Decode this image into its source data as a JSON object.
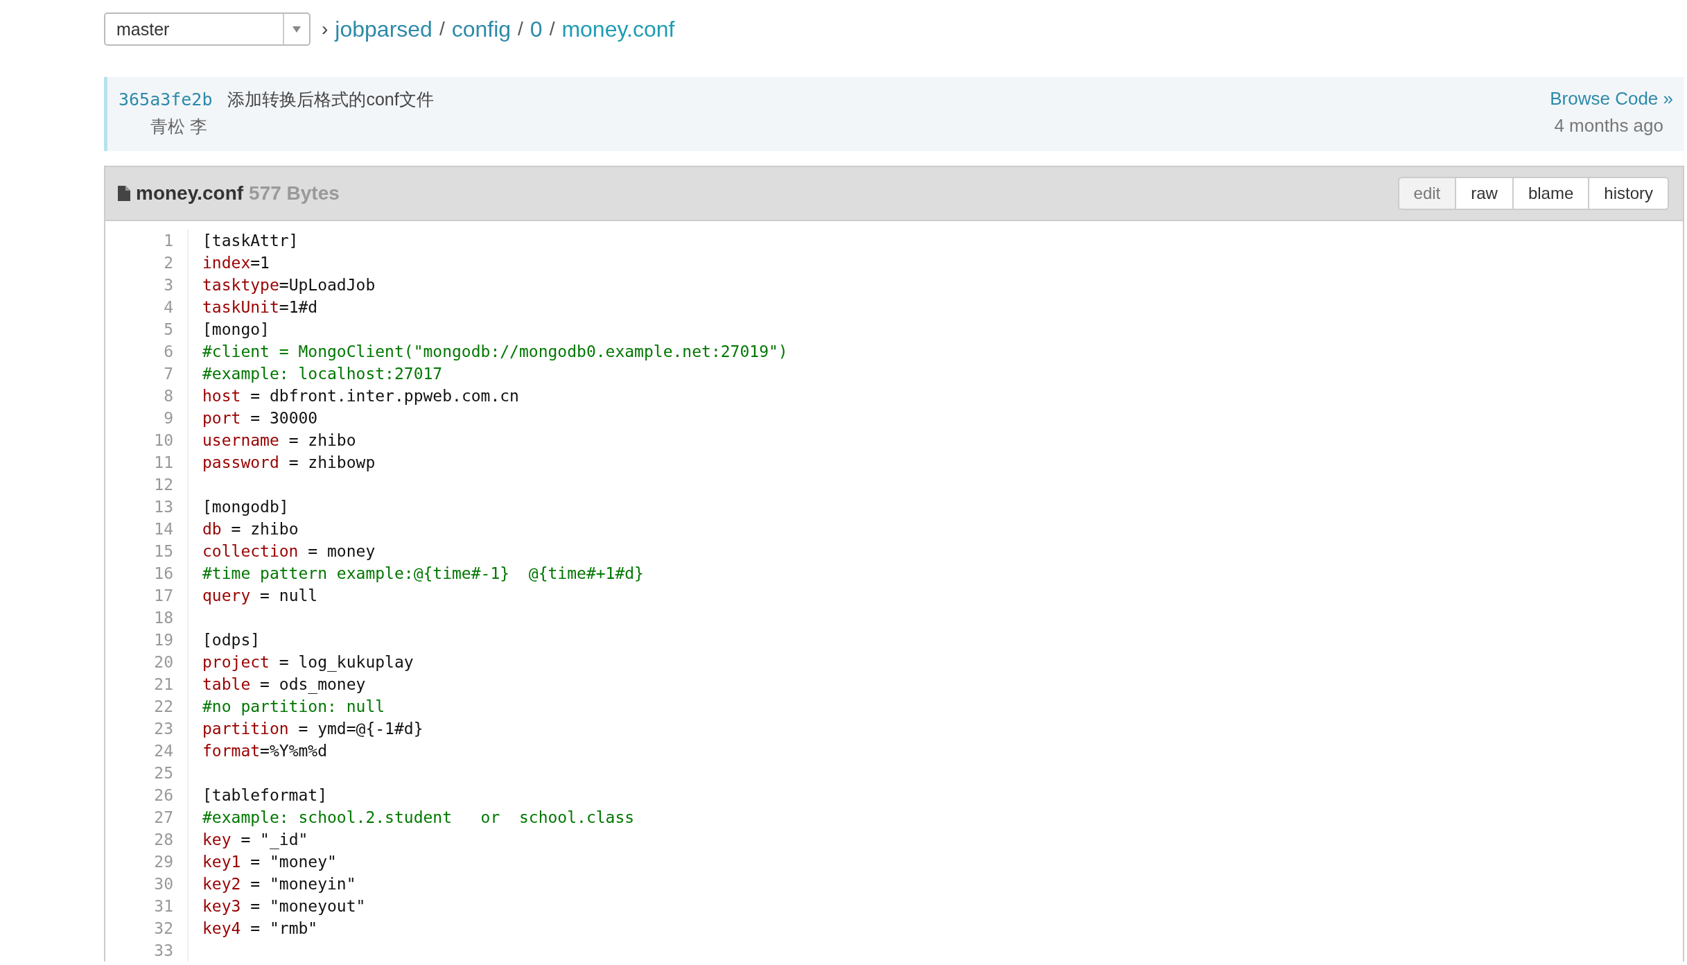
{
  "branch_select": {
    "value": "master"
  },
  "breadcrumb": {
    "separator": "›",
    "parts": [
      {
        "label": "jobparsed",
        "current": false
      },
      {
        "label": "config",
        "current": false
      },
      {
        "label": "0",
        "current": false
      },
      {
        "label": "money.conf",
        "current": true
      }
    ],
    "divider": "/"
  },
  "commit": {
    "sha": "365a3fe2b",
    "message": "添加转换后格式的conf文件",
    "author": "青松 李",
    "browse_link": "Browse Code »",
    "time": "4 months ago"
  },
  "file": {
    "name": "money.conf",
    "size": "577 Bytes",
    "actions": [
      {
        "label": "edit",
        "disabled": true
      },
      {
        "label": "raw",
        "disabled": false
      },
      {
        "label": "blame",
        "disabled": false
      },
      {
        "label": "history",
        "disabled": false
      }
    ],
    "lines": [
      {
        "number": "1",
        "kind": "section",
        "text": "[taskAttr]"
      },
      {
        "number": "2",
        "kind": "pair",
        "key": "index",
        "value": "=1"
      },
      {
        "number": "3",
        "kind": "pair",
        "key": "tasktype",
        "value": "=UpLoadJob"
      },
      {
        "number": "4",
        "kind": "pair",
        "key": "taskUnit",
        "value": "=1#d"
      },
      {
        "number": "5",
        "kind": "section",
        "text": "[mongo]"
      },
      {
        "number": "6",
        "kind": "comment",
        "text": "#client = MongoClient(\"mongodb://mongodb0.example.net:27019\")"
      },
      {
        "number": "7",
        "kind": "comment",
        "text": "#example: localhost:27017"
      },
      {
        "number": "8",
        "kind": "pair",
        "key": "host",
        "value": " = dbfront.inter.ppweb.com.cn"
      },
      {
        "number": "9",
        "kind": "pair",
        "key": "port",
        "value": " = 30000"
      },
      {
        "number": "10",
        "kind": "pair",
        "key": "username",
        "value": " = zhibo"
      },
      {
        "number": "11",
        "kind": "pair",
        "key": "password",
        "value": " = zhibowp"
      },
      {
        "number": "12",
        "kind": "blank"
      },
      {
        "number": "13",
        "kind": "section",
        "text": "[mongodb]"
      },
      {
        "number": "14",
        "kind": "pair",
        "key": "db",
        "value": " = zhibo"
      },
      {
        "number": "15",
        "kind": "pair",
        "key": "collection",
        "value": " = money"
      },
      {
        "number": "16",
        "kind": "comment",
        "text": "#time pattern example:@{time#-1}  @{time#+1#d}"
      },
      {
        "number": "17",
        "kind": "pair",
        "key": "query",
        "value": " = null"
      },
      {
        "number": "18",
        "kind": "blank"
      },
      {
        "number": "19",
        "kind": "section",
        "text": "[odps]"
      },
      {
        "number": "20",
        "kind": "pair",
        "key": "project",
        "value": " = log_kukuplay"
      },
      {
        "number": "21",
        "kind": "pair",
        "key": "table",
        "value": " = ods_money"
      },
      {
        "number": "22",
        "kind": "comment",
        "text": "#no partition: null"
      },
      {
        "number": "23",
        "kind": "pair",
        "key": "partition",
        "value": " = ymd=@{-1#d}"
      },
      {
        "number": "24",
        "kind": "pair",
        "key": "format",
        "value": "=%Y%m%d"
      },
      {
        "number": "25",
        "kind": "blank"
      },
      {
        "number": "26",
        "kind": "section",
        "text": "[tableformat]"
      },
      {
        "number": "27",
        "kind": "comment",
        "text": "#example: school.2.student   or  school.class"
      },
      {
        "number": "28",
        "kind": "pair",
        "key": "key",
        "value": " = \"_id\""
      },
      {
        "number": "29",
        "kind": "pair",
        "key": "key1",
        "value": " = \"money\""
      },
      {
        "number": "30",
        "kind": "pair",
        "key": "key2",
        "value": " = \"moneyin\""
      },
      {
        "number": "31",
        "kind": "pair",
        "key": "key3",
        "value": " = \"moneyout\""
      },
      {
        "number": "32",
        "kind": "pair",
        "key": "key4",
        "value": " = \"rmb\""
      },
      {
        "number": "33",
        "kind": "blank"
      }
    ]
  }
}
